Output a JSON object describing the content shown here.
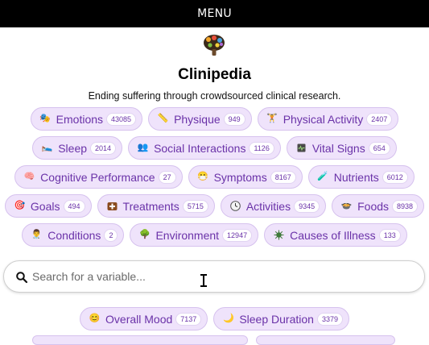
{
  "header": {
    "menu_label": "MENU"
  },
  "site": {
    "title": "Clinipedia",
    "tagline": "Ending suffering through crowdsourced clinical research."
  },
  "categories": [
    [
      {
        "label": "Emotions",
        "count": "43085",
        "icon": "theater-masks-icon"
      },
      {
        "label": "Physique",
        "count": "949",
        "icon": "ruler-icon"
      },
      {
        "label": "Physical Activity",
        "count": "2407",
        "icon": "weightlifter-icon"
      }
    ],
    [
      {
        "label": "Sleep",
        "count": "2014",
        "icon": "bed-icon"
      },
      {
        "label": "Social Interactions",
        "count": "1126",
        "icon": "people-icon"
      },
      {
        "label": "Vital Signs",
        "count": "654",
        "icon": "monitor-icon"
      }
    ],
    [
      {
        "label": "Cognitive Performance",
        "count": "27",
        "icon": "brain-icon"
      },
      {
        "label": "Symptoms",
        "count": "8167",
        "icon": "sick-face-icon"
      },
      {
        "label": "Nutrients",
        "count": "6012",
        "icon": "flask-icon"
      }
    ],
    [
      {
        "label": "Goals",
        "count": "494",
        "icon": "target-icon"
      },
      {
        "label": "Treatments",
        "count": "5715",
        "icon": "medicine-box-icon"
      },
      {
        "label": "Activities",
        "count": "9345",
        "icon": "clock-icon"
      },
      {
        "label": "Foods",
        "count": "8938",
        "icon": "food-icon"
      }
    ],
    [
      {
        "label": "Conditions",
        "count": "2",
        "icon": "doctor-icon"
      },
      {
        "label": "Environment",
        "count": "12947",
        "icon": "tree-icon"
      },
      {
        "label": "Causes of Illness",
        "count": "133",
        "icon": "virus-icon"
      }
    ]
  ],
  "search": {
    "placeholder": "Search for a variable...",
    "value": ""
  },
  "suggestions": [
    {
      "label": "Overall Mood",
      "count": "7137",
      "icon": "smiley-icon"
    },
    {
      "label": "Sleep Duration",
      "count": "3379",
      "icon": "moon-icon"
    }
  ]
}
